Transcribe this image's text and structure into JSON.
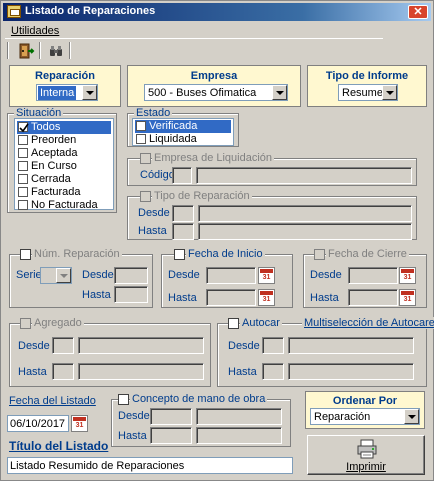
{
  "window": {
    "title": "Listado de Reparaciones",
    "close_label": "✕"
  },
  "menu": {
    "utilidades": "Utilidades"
  },
  "header": {
    "reparacion": {
      "label": "Reparación",
      "value": "Interna"
    },
    "empresa": {
      "label": "Empresa",
      "value": "500 - Buses Ofimatica"
    },
    "tipo_informe": {
      "label": "Tipo de Informe",
      "value": "Resumen"
    }
  },
  "situacion": {
    "label": "Situación",
    "items": [
      "Todos",
      "Preorden",
      "Aceptada",
      "En Curso",
      "Cerrada",
      "Facturada",
      "No Facturada"
    ],
    "checked": [
      true,
      false,
      false,
      false,
      false,
      false,
      false
    ]
  },
  "estado": {
    "label": "Estado",
    "items": [
      "Verificada",
      "Liquidada"
    ]
  },
  "empresa_liquidacion": {
    "label": "Empresa de Liquidación",
    "codigo": "Código"
  },
  "tipo_reparacion": {
    "label": "Tipo de Reparación",
    "desde": "Desde",
    "hasta": "Hasta"
  },
  "num_reparacion": {
    "label": "Núm. Reparación",
    "serie": "Serie",
    "desde": "Desde",
    "hasta": "Hasta"
  },
  "fecha_inicio": {
    "label": "Fecha de Inicio",
    "desde": "Desde",
    "hasta": "Hasta"
  },
  "fecha_cierre": {
    "label": "Fecha de Cierre",
    "desde": "Desde",
    "hasta": "Hasta"
  },
  "agregado": {
    "label": "Agregado",
    "desde": "Desde",
    "hasta": "Hasta"
  },
  "autocar": {
    "label": "Autocar",
    "multiselect": "Multiselección de Autocares",
    "desde": "Desde",
    "hasta": "Hasta"
  },
  "fecha_listado": {
    "label": "Fecha del Listado",
    "value": "06/10/2017"
  },
  "mano_obra": {
    "label": "Concepto de mano de obra",
    "desde": "Desde",
    "hasta": "Hasta"
  },
  "ordenar": {
    "label": "Ordenar Por",
    "value": "Reparación"
  },
  "titulo_listado": {
    "label": "Título del Listado",
    "value": "Listado Resumido de Reparaciones"
  },
  "imprimir": {
    "label": "Imprimir"
  },
  "calendar": {
    "top_text": "31",
    "colors": {
      "red": "#c03020"
    }
  },
  "colors": {
    "accent_label": "#003c8c",
    "header_bg": "#fff8d0",
    "selection": "#316ac5"
  }
}
